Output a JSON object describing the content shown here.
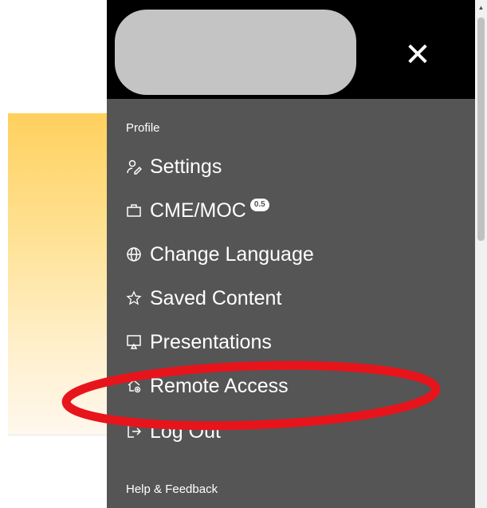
{
  "menu": {
    "close_label": "✕",
    "sections": {
      "profile_label": "Profile",
      "help_label": "Help & Feedback"
    },
    "items": [
      {
        "label": "Settings",
        "icon": "settings-person-icon"
      },
      {
        "label": "CME/MOC",
        "icon": "briefcase-icon",
        "badge": "0.5"
      },
      {
        "label": "Change Language",
        "icon": "globe-icon"
      },
      {
        "label": "Saved Content",
        "icon": "star-icon"
      },
      {
        "label": "Presentations",
        "icon": "presentation-icon"
      },
      {
        "label": "Remote Access",
        "icon": "remote-home-icon"
      },
      {
        "label": "Log Out",
        "icon": "logout-icon"
      }
    ]
  },
  "colors": {
    "menu_bg": "#555555",
    "header_bg": "#000000",
    "annotation_ring": "#e8141c"
  }
}
